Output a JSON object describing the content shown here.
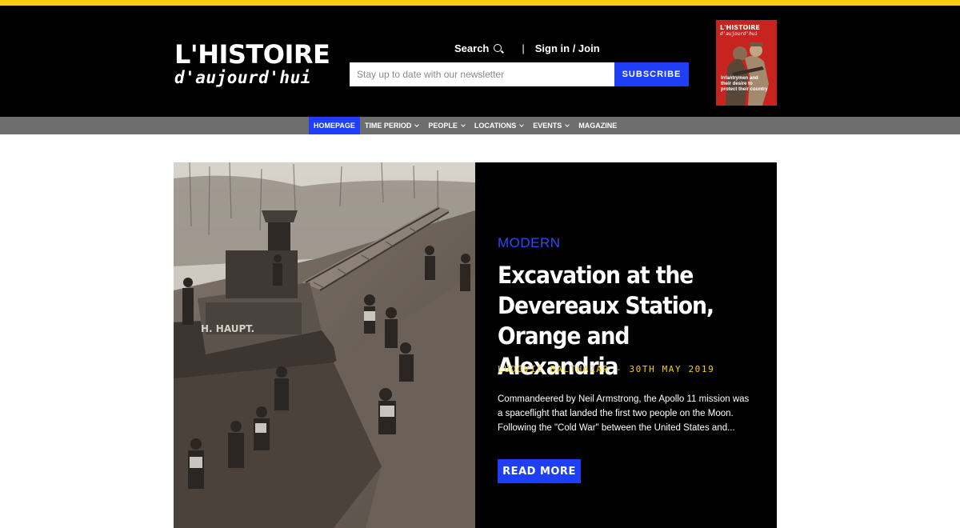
{
  "header": {
    "logo_line1": "L'HISTOIRE",
    "logo_line2": "d'aujourd'hui",
    "search_label": "Search",
    "separator": "|",
    "signin_label": "Sign in / Join",
    "newsletter_placeholder": "Stay up to date with our newsletter",
    "subscribe_label": "SUBSCRIBE",
    "cover": {
      "title": "L'HISTOIRE",
      "subtitle": "d'aujourd'hui",
      "text": "Infantrymen and their desire to protect their country"
    }
  },
  "nav": {
    "items": [
      {
        "label": "HOMEPAGE",
        "active": true,
        "dropdown": false
      },
      {
        "label": "TIME PERIOD",
        "active": false,
        "dropdown": true
      },
      {
        "label": "PEOPLE",
        "active": false,
        "dropdown": true
      },
      {
        "label": "LOCATIONS",
        "active": false,
        "dropdown": true
      },
      {
        "label": "EVENTS",
        "active": false,
        "dropdown": true
      },
      {
        "label": "MAGAZINE",
        "active": false,
        "dropdown": false
      }
    ]
  },
  "hero": {
    "category": "MODERN",
    "title": "Excavation at the Devereaux Station, Orange and Alexandria",
    "byline": "LUDOVIC BALTHAZAR - 30TH MAY 2019",
    "excerpt": "Commandeered by Neil Armstrong, the Apollo 11 mission was a spaceflight that landed the first two people on the Moon. Following the \"Cold War\" between the United States and...",
    "read_more_label": "READ MORE",
    "locomotive_text": "H. HAUPT."
  },
  "colors": {
    "accent_blue": "#1e3ff5",
    "accent_yellow": "#f7cd1c",
    "header_bg": "#000000",
    "nav_bg": "#6e6e6e"
  }
}
